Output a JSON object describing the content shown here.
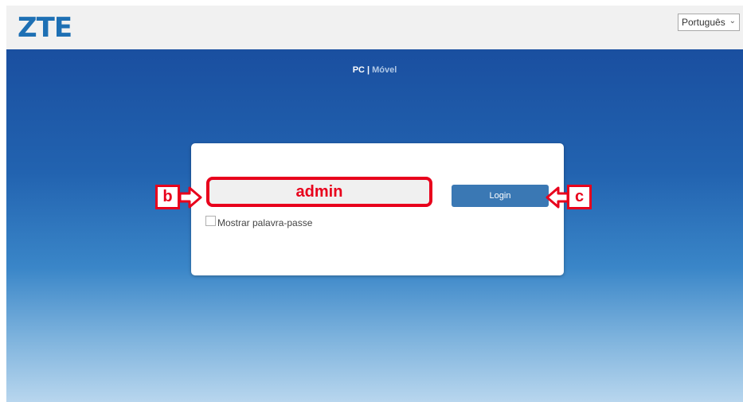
{
  "header": {
    "logo": "ZTE",
    "language": "Português"
  },
  "mode_switch": {
    "pc": "PC",
    "separator": "|",
    "mobile": "Móvel"
  },
  "login": {
    "password_value": "admin",
    "login_button": "Login",
    "show_password_label": "Mostrar palavra-passe"
  },
  "annotations": {
    "b": "b",
    "c": "c",
    "color": "#e8001c"
  },
  "colors": {
    "brand": "#1e70b4",
    "button": "#3a78b4",
    "background_top": "#1a4fa0"
  }
}
